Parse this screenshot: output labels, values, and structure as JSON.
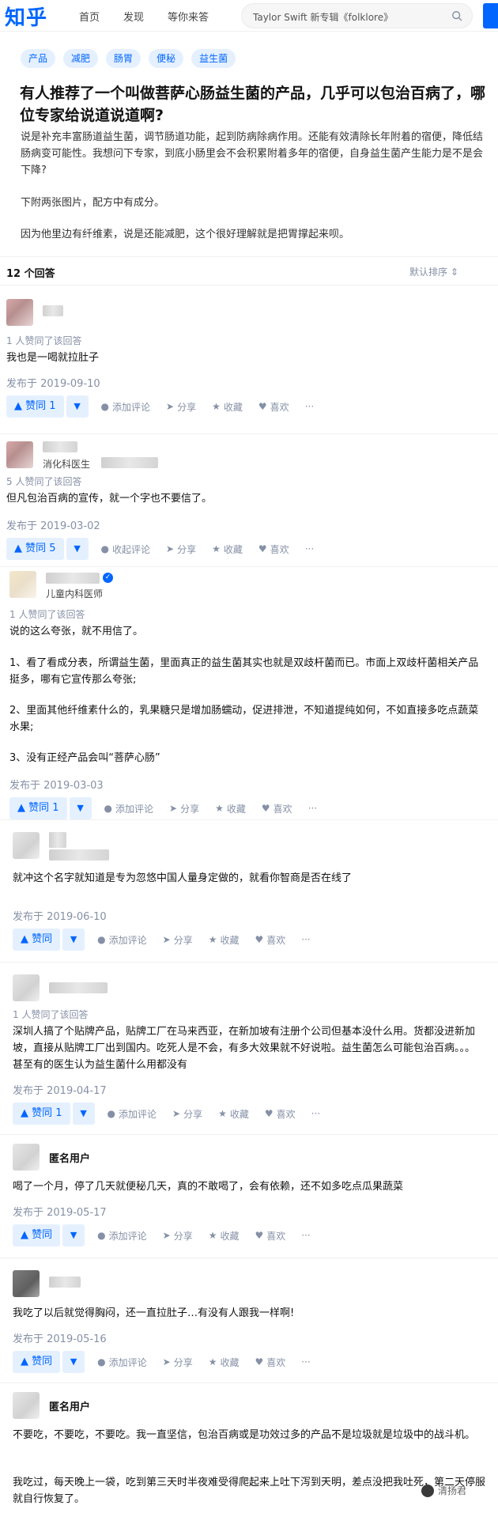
{
  "header": {
    "logo": "知乎",
    "nav": [
      "首页",
      "发现",
      "等你来答"
    ],
    "search_text": "Taylor Swift 新专辑《folklore》"
  },
  "question": {
    "topics": [
      "产品",
      "减肥",
      "肠胃",
      "便秘",
      "益生菌"
    ],
    "title": "有人推荐了一个叫做菩萨心肠益生菌的产品，几乎可以包治百病了，哪位专家给说道说道啊?",
    "body": [
      "说是补充丰富肠道益生菌，调节肠道功能，起到防病除病作用。还能有效清除长年附着的宿便，降低结肠病变可能性。我想问下专家，到底小肠里会不会积累附着多年的宿便，自身益生菌产生能力是不是会下降?",
      "下附两张图片，配方中有成分。",
      "因为他里边有纤维素，说是还能减肥，这个很好理解就是把胃撑起来呗。"
    ]
  },
  "answers_bar": {
    "count": "12 个回答",
    "sort": "默认排序"
  },
  "labels": {
    "published_prefix": "发布于",
    "comment": "添加评论",
    "collapse_comment": "收起评论",
    "share": "分享",
    "collect": "收藏",
    "like": "喜欢",
    "more": "···",
    "anonymous": "匿名用户"
  },
  "answers": [
    {
      "upvoted": "1 人赞同了该回答",
      "text": "我也是一喝就拉肚子",
      "date": "发布于 2019-09-10",
      "vote": "▲ 赞同 1",
      "comment": "添加评论"
    },
    {
      "headline": "消化科医生",
      "upvoted": "5 人赞同了该回答",
      "text": "但凡包治百病的宣传，就一个字也不要信了。",
      "date": "发布于 2019-03-02",
      "vote": "▲ 赞同 5",
      "comment": "收起评论"
    },
    {
      "headline": "儿童内科医师",
      "upvoted": "1 人赞同了该回答",
      "paragraphs": [
        "说的这么夸张，就不用信了。",
        "1、看了看成分表，所谓益生菌，里面真正的益生菌其实也就是双歧杆菌而已。市面上双歧杆菌相关产品挺多，哪有它宣传那么夸张;",
        "2、里面其他纤维素什么的，乳果糖只是增加肠蠕动，促进排泄，不知道提纯如何，不如直接多吃点蔬菜水果;",
        "3、没有正经产品会叫“菩萨心肠”"
      ],
      "date": "发布于 2019-03-03",
      "vote": "▲ 赞同 1",
      "comment": "添加评论"
    },
    {
      "text": "就冲这个名字就知道是专为忽悠中国人量身定做的，就看你智商是否在线了",
      "date": "发布于 2019-06-10",
      "vote": "▲ 赞同",
      "comment": "添加评论"
    },
    {
      "upvoted": "1 人赞同了该回答",
      "text": "深圳人搞了个贴牌产品，贴牌工厂在马来西亚，在新加坡有注册个公司但基本没什么用。货都没进新加坡，直接从贴牌工厂出到国内。吃死人是不会，有多大效果就不好说啦。益生菌怎么可能包治百病。。。甚至有的医生认为益生菌什么用都没有",
      "date": "发布于 2019-04-17",
      "vote": "▲ 赞同 1",
      "comment": "添加评论"
    },
    {
      "text": "喝了一个月，停了几天就便秘几天，真的不敢喝了，会有依赖，还不如多吃点瓜果蔬菜",
      "date": "发布于 2019-05-17",
      "vote": "▲ 赞同",
      "comment": "添加评论"
    },
    {
      "text": "我吃了以后就觉得胸闷，还一直拉肚子…有没有人跟我一样啊!",
      "date": "发布于 2019-05-16",
      "vote": "▲ 赞同",
      "comment": "添加评论"
    },
    {
      "paragraphs": [
        "不要吃，不要吃，不要吃。我一直坚信，包治百病或是功效过多的产品不是垃圾就是垃圾中的战斗机。",
        "我吃过，每天晚上一袋，吃到第三天时半夜难受得爬起来上吐下泻到天明，差点没把我吐死，第二天停服就自行恢复了。"
      ]
    }
  ],
  "watermark": "清扬君"
}
